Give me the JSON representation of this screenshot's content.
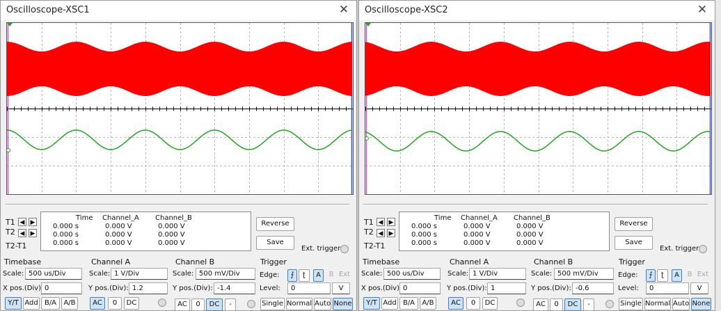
{
  "scopes": [
    {
      "title": "Oscilloscope-XSC1",
      "close": "✕",
      "cursor_labels": [
        "T1",
        "T2",
        "T2-T1"
      ],
      "buttons": {
        "reverse": "Reverse",
        "save": "Save",
        "ext_trigger": "Ext. trigger"
      },
      "readout": {
        "headers": [
          "Time",
          "Channel_A",
          "Channel_B"
        ],
        "rows": [
          [
            "0.000 s",
            "0.000 V",
            "0.000 V"
          ],
          [
            "0.000 s",
            "0.000 V",
            "0.000 V"
          ],
          [
            "0.000 s",
            "0.000 V",
            "0.000 V"
          ]
        ]
      },
      "timebase": {
        "title": "Timebase",
        "scale_label": "Scale:",
        "scale": "500 us/Div",
        "xpos_label": "X pos.(Div):",
        "xpos": "0",
        "modes": [
          "Y/T",
          "Add",
          "B/A",
          "A/B"
        ],
        "selected_mode": "Y/T"
      },
      "channel_a": {
        "title": "Channel A",
        "scale_label": "Scale:",
        "scale": "1  V/Div",
        "ypos_label": "Y pos.(Div):",
        "ypos": "1.2",
        "coupling": [
          "AC",
          "0",
          "DC"
        ],
        "selected": "AC"
      },
      "channel_b": {
        "title": "Channel B",
        "scale_label": "Scale:",
        "scale": "500 mV/Div",
        "ypos_label": "Y pos.(Div):",
        "ypos": "-1.4",
        "coupling": [
          "AC",
          "0",
          "DC",
          "-"
        ],
        "selected": "DC"
      },
      "trigger": {
        "title": "Trigger",
        "edge_label": "Edge:",
        "edge_buttons": [
          "⨍",
          "ʈ",
          "A",
          "B",
          "Ext"
        ],
        "level_label": "Level:",
        "level": "0",
        "unit": "V",
        "modes": [
          "Single",
          "Normal",
          "Auto",
          "None"
        ],
        "selected_mode": "None"
      },
      "trace": {
        "a_color": "#ff0000",
        "b_color": "#1ea81e",
        "b_offset_frac": 0.0
      }
    },
    {
      "title": "Oscilloscope-XSC2",
      "close": "✕",
      "cursor_labels": [
        "T1",
        "T2",
        "T2-T1"
      ],
      "buttons": {
        "reverse": "Reverse",
        "save": "Save",
        "ext_trigger": "Ext. trigger"
      },
      "readout": {
        "headers": [
          "Time",
          "Channel_A",
          "Channel_B"
        ],
        "rows": [
          [
            "0.000 s",
            "0.000 V",
            "0.000 V"
          ],
          [
            "0.000 s",
            "0.000 V",
            "0.000 V"
          ],
          [
            "0.000 s",
            "0.000 V",
            "0.000 V"
          ]
        ]
      },
      "timebase": {
        "title": "Timebase",
        "scale_label": "Scale:",
        "scale": "500 us/Div",
        "xpos_label": "X pos.(Div):",
        "xpos": "0",
        "modes": [
          "Y/T",
          "Add",
          "B/A",
          "A/B"
        ],
        "selected_mode": "Y/T"
      },
      "channel_a": {
        "title": "Channel A",
        "scale_label": "Scale:",
        "scale": "1  V/Div",
        "ypos_label": "Y pos.(Div):",
        "ypos": "1",
        "coupling": [
          "AC",
          "0",
          "DC"
        ],
        "selected": "AC"
      },
      "channel_b": {
        "title": "Channel B",
        "scale_label": "Scale:",
        "scale": "500 mV/Div",
        "ypos_label": "Y pos.(Div):",
        "ypos": "-0.6",
        "coupling": [
          "AC",
          "0",
          "DC",
          "-"
        ],
        "selected": "DC"
      },
      "trigger": {
        "title": "Trigger",
        "edge_label": "Edge:",
        "edge_buttons": [
          "⨍",
          "ʈ",
          "A",
          "B",
          "Ext"
        ],
        "level_label": "Level:",
        "level": "0",
        "unit": "V",
        "modes": [
          "Single",
          "Normal",
          "Auto",
          "None"
        ],
        "selected_mode": "None"
      },
      "trace": {
        "a_color": "#ff0000",
        "b_color": "#1ea81e",
        "b_offset_frac": 0.0
      }
    }
  ]
}
